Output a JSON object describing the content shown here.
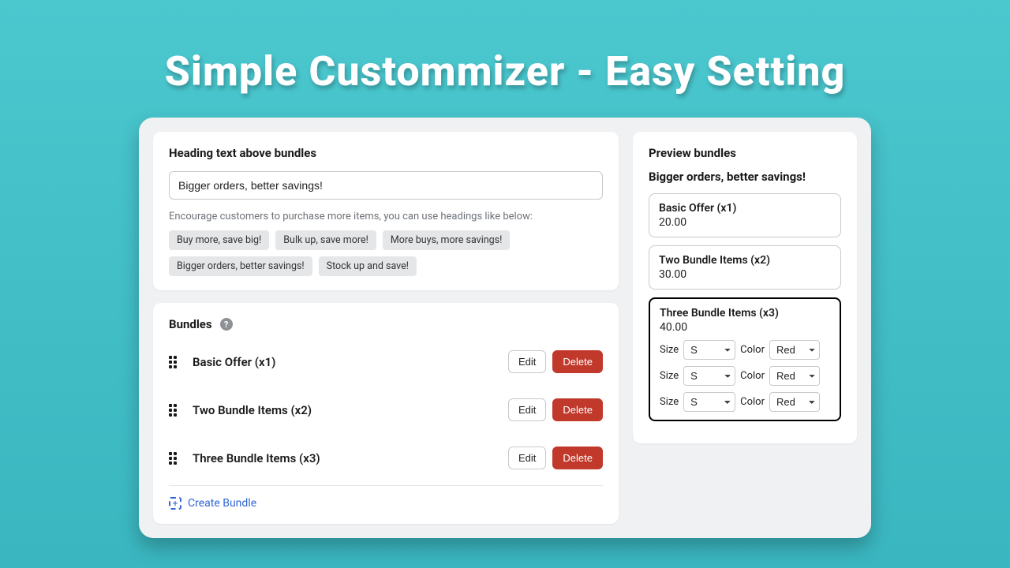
{
  "page_title": "Simple Custommizer -  Easy Setting",
  "heading_section": {
    "title": "Heading text above bundles",
    "input_value": "Bigger orders, better savings!",
    "hint": "Encourage customers to purchase more items, you can use headings like below:",
    "chips": [
      "Buy more, save big!",
      "Bulk up, save more!",
      "More buys, more savings!",
      "Bigger orders, better savings!",
      "Stock up and save!"
    ]
  },
  "bundles_section": {
    "title": "Bundles",
    "help": "?",
    "edit_label": "Edit",
    "delete_label": "Delete",
    "create_label": "Create Bundle",
    "items": [
      {
        "name": "Basic Offer (x1)"
      },
      {
        "name": "Two Bundle Items (x2)"
      },
      {
        "name": "Three Bundle Items (x3)"
      }
    ]
  },
  "preview": {
    "title": "Preview bundles",
    "heading": "Bigger orders, better savings!",
    "size_label": "Size",
    "color_label": "Color",
    "offers": [
      {
        "name": "Basic Offer (x1)",
        "price": "20.00"
      },
      {
        "name": "Two Bundle Items (x2)",
        "price": "30.00"
      },
      {
        "name": "Three Bundle Items (x3)",
        "price": "40.00"
      }
    ],
    "size_value": "S",
    "color_value": "Red"
  }
}
